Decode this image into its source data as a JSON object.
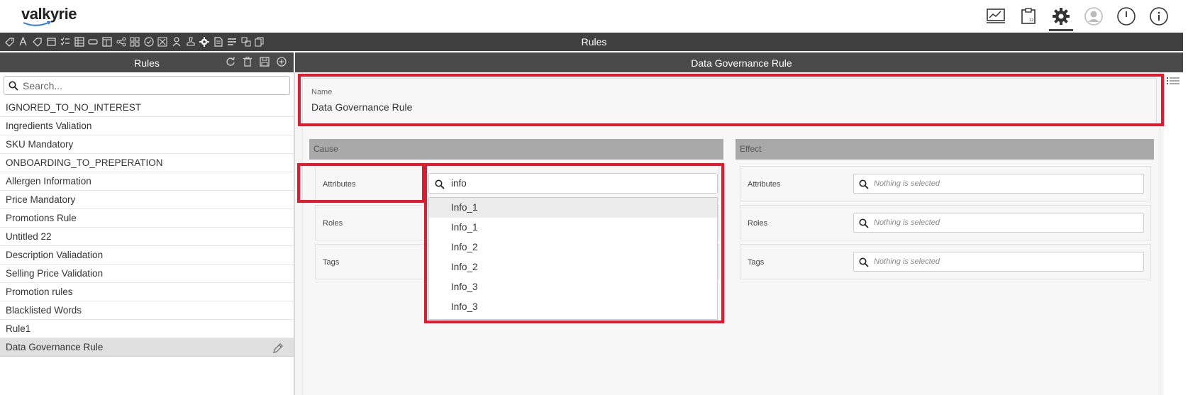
{
  "header": {
    "logo_text": "valkyrie",
    "icons": [
      "dashboard-icon",
      "package-icon",
      "settings-icon",
      "user-icon",
      "power-icon",
      "info-icon"
    ]
  },
  "toolbar": {
    "title": "Rules",
    "icons": [
      "tag-icon",
      "font-icon",
      "label-icon",
      "calendar-icon",
      "checklist-icon",
      "table-icon",
      "card-icon",
      "layout-icon",
      "share-icon",
      "grid-icon",
      "check-circle-icon",
      "network-icon",
      "person-icon",
      "stamp-icon",
      "gear-icon",
      "document-icon",
      "list-icon",
      "translate-icon",
      "copy-icon"
    ]
  },
  "left_panel": {
    "title": "Rules",
    "search_placeholder": "Search...",
    "items": [
      {
        "label": "IGNORED_TO_NO_INTEREST"
      },
      {
        "label": "Ingredients Valiation"
      },
      {
        "label": "SKU Mandatory"
      },
      {
        "label": "ONBOARDING_TO_PREPERATION"
      },
      {
        "label": "Allergen Information"
      },
      {
        "label": "Price Mandatory"
      },
      {
        "label": "Promotions Rule"
      },
      {
        "label": "Untitled 22"
      },
      {
        "label": "Description Valiadation"
      },
      {
        "label": "Selling Price Validation"
      },
      {
        "label": "Promotion rules"
      },
      {
        "label": "Blacklisted Words"
      },
      {
        "label": "Rule1"
      },
      {
        "label": "Data Governance Rule"
      }
    ]
  },
  "right_panel": {
    "title": "Data Governance Rule",
    "name_label": "Name",
    "name_value": "Data Governance Rule",
    "cause": {
      "title": "Cause",
      "attributes_label": "Attributes",
      "roles_label": "Roles",
      "tags_label": "Tags",
      "attributes_search_value": "info",
      "options": [
        "Info_1",
        "Info_1",
        "Info_2",
        "Info_2",
        "Info_3",
        "Info_3"
      ]
    },
    "effect": {
      "title": "Effect",
      "attributes_label": "Attributes",
      "roles_label": "Roles",
      "tags_label": "Tags",
      "placeholder": "Nothing is selected"
    }
  },
  "colors": {
    "toolbar_bg": "#3f3f3f",
    "panel_header_bg": "#4a4a4a",
    "section_header_bg": "#a9a9a9",
    "highlight": "#e3192d",
    "selected_row": "#e0e0e0"
  }
}
